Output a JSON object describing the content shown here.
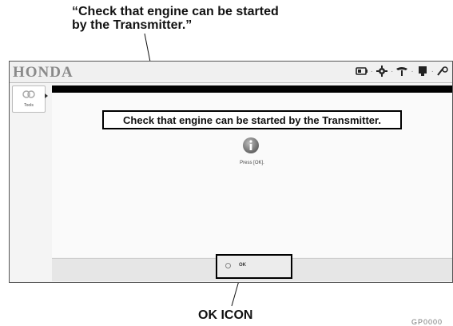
{
  "callouts": {
    "top_line1": "“Check that engine can be started",
    "top_line2": "by the Transmitter.”",
    "bottom": "OK ICON"
  },
  "figure_code": "GP0000",
  "app": {
    "logo": "HONDA",
    "toolbar_icons": [
      "battery-icon",
      "gear-icon",
      "steering-wheel-icon",
      "monitor-icon",
      "tools-icon"
    ]
  },
  "sidebar": {
    "button_label": "Tools",
    "button_icon": "wrench-icon"
  },
  "main": {
    "message": "Check that engine can be started by the Transmitter.",
    "info_icon": "info-icon",
    "instruction": "Press [OK]."
  },
  "footer": {
    "ok_label": "OK"
  }
}
